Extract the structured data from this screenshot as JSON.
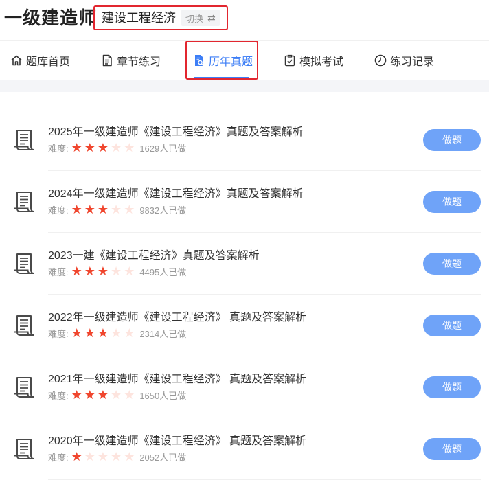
{
  "header": {
    "app_title": "一级建造师",
    "subject": "建设工程经济",
    "switch_label": "切换",
    "switch_glyph": "⇄"
  },
  "nav": {
    "tabs": [
      {
        "label": "题库首页",
        "icon": "home-icon",
        "active": false
      },
      {
        "label": "章节练习",
        "icon": "document-icon",
        "active": false
      },
      {
        "label": "历年真题",
        "icon": "paper-search-icon",
        "active": true
      },
      {
        "label": "模拟考试",
        "icon": "checklist-icon",
        "active": false
      },
      {
        "label": "练习记录",
        "icon": "clock-record-icon",
        "active": false
      }
    ],
    "accent_color": "#3d7ef6"
  },
  "papers": {
    "difficulty_label": "难度:",
    "button_label": "做题",
    "items": [
      {
        "title": "2025年一级建造师《建设工程经济》真题及答案解析",
        "stars": 3,
        "count": "1629人已做"
      },
      {
        "title": "2024年一级建造师《建设工程经济》真题及答案解析",
        "stars": 3,
        "count": "9832人已做"
      },
      {
        "title": "2023一建《建设工程经济》真题及答案解析",
        "stars": 3,
        "count": "4495人已做"
      },
      {
        "title": "2022年一级建造师《建设工程经济》 真题及答案解析",
        "stars": 3,
        "count": "2314人已做"
      },
      {
        "title": "2021年一级建造师《建设工程经济》 真题及答案解析",
        "stars": 3,
        "count": "1650人已做"
      },
      {
        "title": "2020年一级建造师《建设工程经济》 真题及答案解析",
        "stars": 1,
        "count": "2052人已做"
      }
    ],
    "max_stars": 5,
    "star_color": "#f0462e",
    "button_color": "#6fa3f8"
  }
}
